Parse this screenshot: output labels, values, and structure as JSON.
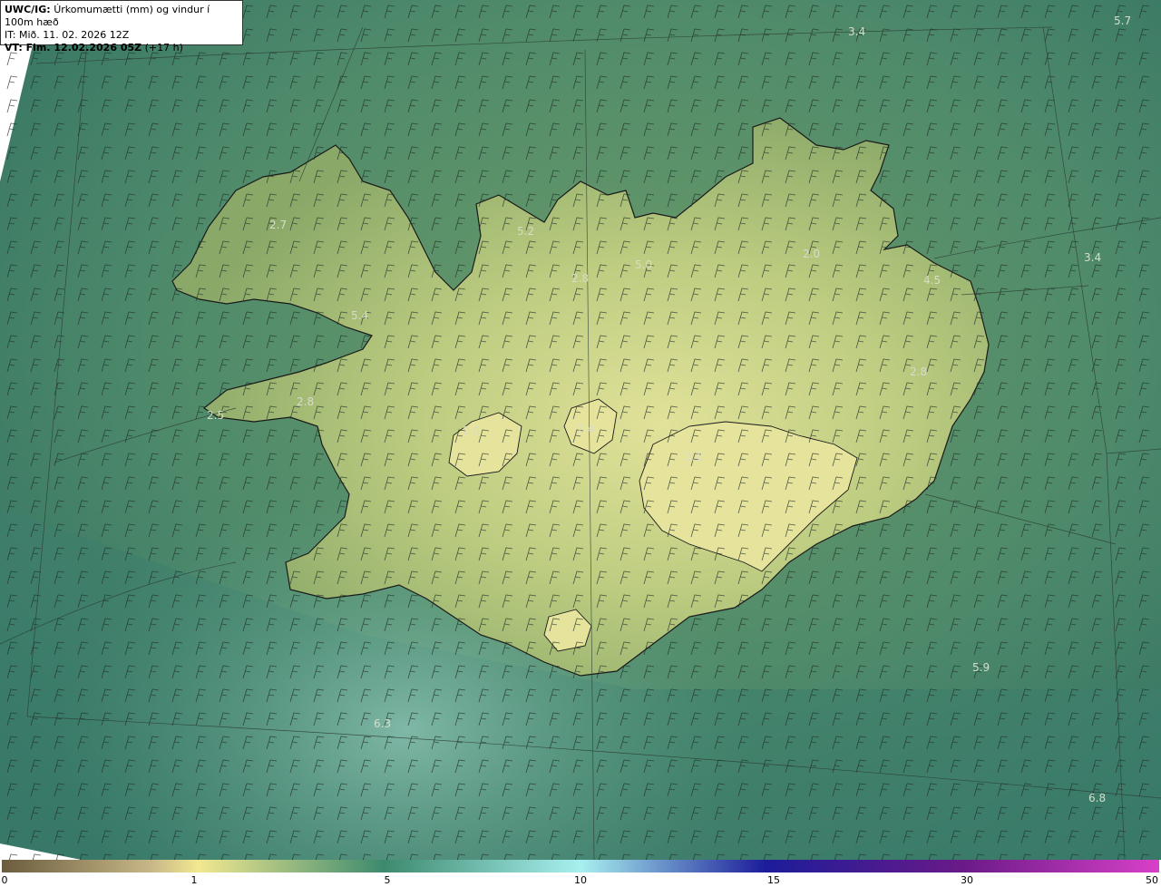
{
  "header": {
    "model": "UWC/IG:",
    "description": "Úrkomumætti (mm) og vindur í 100m hæð",
    "it_line": "IT: Mið. 11. 02. 2026 12Z",
    "vt_bold": "VT: Fim. 12.02.2026 05Z",
    "vt_offset": "(+17 h)"
  },
  "colorbar": {
    "ticks": [
      "0",
      "1",
      "5",
      "10",
      "15",
      "30",
      "50"
    ],
    "colors": [
      "#6a5c3e",
      "#c8c88a",
      "#f0e690",
      "#3c8a6e",
      "#a0e8e8",
      "#2020a0",
      "#5a1080",
      "#d040c0"
    ]
  },
  "value_labels": [
    {
      "text": "5.7"
    },
    {
      "text": "3.4"
    },
    {
      "text": "2.7"
    },
    {
      "text": "5.2"
    },
    {
      "text": "2.8"
    },
    {
      "text": "5.0"
    },
    {
      "text": "2.0"
    },
    {
      "text": "5.4"
    },
    {
      "text": "4.5"
    },
    {
      "text": "3.4"
    },
    {
      "text": "2.8"
    },
    {
      "text": "2.5"
    },
    {
      "text": "2.8"
    },
    {
      "text": "2.1"
    },
    {
      "text": "2.4"
    },
    {
      "text": "2.0"
    },
    {
      "text": "5.9"
    },
    {
      "text": "6.3"
    },
    {
      "text": "6.8"
    }
  ],
  "colors": {
    "sea_dark": "#2f6f63",
    "sea_mid": "#4a8c6c",
    "land_low": "#8aa868",
    "land_high": "#d8dc90",
    "coast": "#1a1a1a"
  }
}
